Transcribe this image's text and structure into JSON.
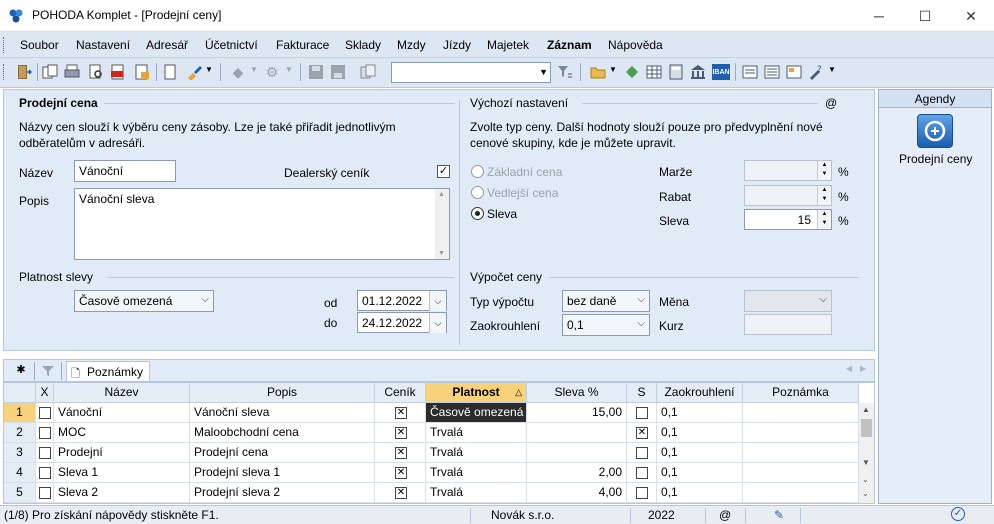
{
  "window": {
    "title": "POHODA Komplet - [Prodejní ceny]",
    "buttons": [
      "─",
      "☐",
      "✕"
    ]
  },
  "menu": [
    "Soubor",
    "Nastavení",
    "Adresář",
    "Účetnictví",
    "Fakturace",
    "Sklady",
    "Mzdy",
    "Jízdy",
    "Majetek",
    "Záznam",
    "Nápověda"
  ],
  "toolbar": {
    "combo_value": ""
  },
  "form": {
    "section_title": "Prodejní cena",
    "description": "Názvy cen slouží k výběru ceny zásoby. Lze je také přiřadit jednotlivým odběratelům v adresáři.",
    "nazev_label": "Název",
    "nazev_value": "Vánoční",
    "dealer_label": "Dealerský ceník",
    "dealer_checked": "✓",
    "popis_label": "Popis",
    "popis_value": "Vánoční sleva",
    "platnost_label": "Platnost slevy",
    "platnost_value": "Časově omezená",
    "od_label": "od",
    "od_value": "01.12.2022",
    "do_label": "do",
    "do_value": "24.12.2022",
    "vychozi_title": "Výchozí nastavení",
    "vychozi_at": "@",
    "vychozi_desc": "Zvolte typ ceny. Další hodnoty slouží pouze pro předvyplnění nové cenové skupiny, kde je můžete upravit.",
    "radio_zakladni": "Základní cena",
    "radio_vedlejsi": "Vedlejší cena",
    "radio_sleva": "Sleva",
    "marze_label": "Marže",
    "rabat_label": "Rabat",
    "sleva_label": "Sleva",
    "sleva_value": "15",
    "pct": "%",
    "vypocet_title": "Výpočet ceny",
    "typ_label": "Typ výpočtu",
    "typ_value": "bez daně",
    "zaok_label": "Zaokrouhlení",
    "zaok_value": "0,1",
    "mena_label": "Měna",
    "kurz_label": "Kurz"
  },
  "tabs": {
    "star": "✱",
    "notes": "Poznámky"
  },
  "grid": {
    "columns": [
      "",
      "X",
      "Název",
      "Popis",
      "Ceník",
      "Platnost",
      "Sleva %",
      "S",
      "Zaokrouhlení",
      "Poznámka"
    ],
    "rows": [
      {
        "n": "1",
        "x": "",
        "nazev": "Vánoční",
        "popis": "Vánoční sleva",
        "cenik": "✕",
        "platnost": "Časově omezená",
        "sleva": "15,00",
        "s": "",
        "zaok": "0,1",
        "pozn": ""
      },
      {
        "n": "2",
        "x": "",
        "nazev": "MOC",
        "popis": "Maloobchodní cena",
        "cenik": "✕",
        "platnost": "Trvalá",
        "sleva": "",
        "s": "✕",
        "zaok": "0,1",
        "pozn": ""
      },
      {
        "n": "3",
        "x": "",
        "nazev": "Prodejní",
        "popis": "Prodejní cena",
        "cenik": "✕",
        "platnost": "Trvalá",
        "sleva": "",
        "s": "",
        "zaok": "0,1",
        "pozn": ""
      },
      {
        "n": "4",
        "x": "",
        "nazev": "Sleva 1",
        "popis": "Prodejní sleva 1",
        "cenik": "✕",
        "platnost": "Trvalá",
        "sleva": "2,00",
        "s": "",
        "zaok": "0,1",
        "pozn": ""
      },
      {
        "n": "5",
        "x": "",
        "nazev": "Sleva 2",
        "popis": "Prodejní sleva 2",
        "cenik": "✕",
        "platnost": "Trvalá",
        "sleva": "4,00",
        "s": "",
        "zaok": "0,1",
        "pozn": ""
      }
    ]
  },
  "agendy": {
    "header": "Agendy",
    "item": "Prodejní ceny"
  },
  "status": {
    "help": "(1/8) Pro získání nápovědy stiskněte F1.",
    "company": "Novák s.r.o.",
    "year": "2022",
    "at": "@"
  },
  "colors": {
    "accent": "#f8d27a",
    "panel": "#e1ebf7",
    "toolbar": "#dde6f3"
  }
}
